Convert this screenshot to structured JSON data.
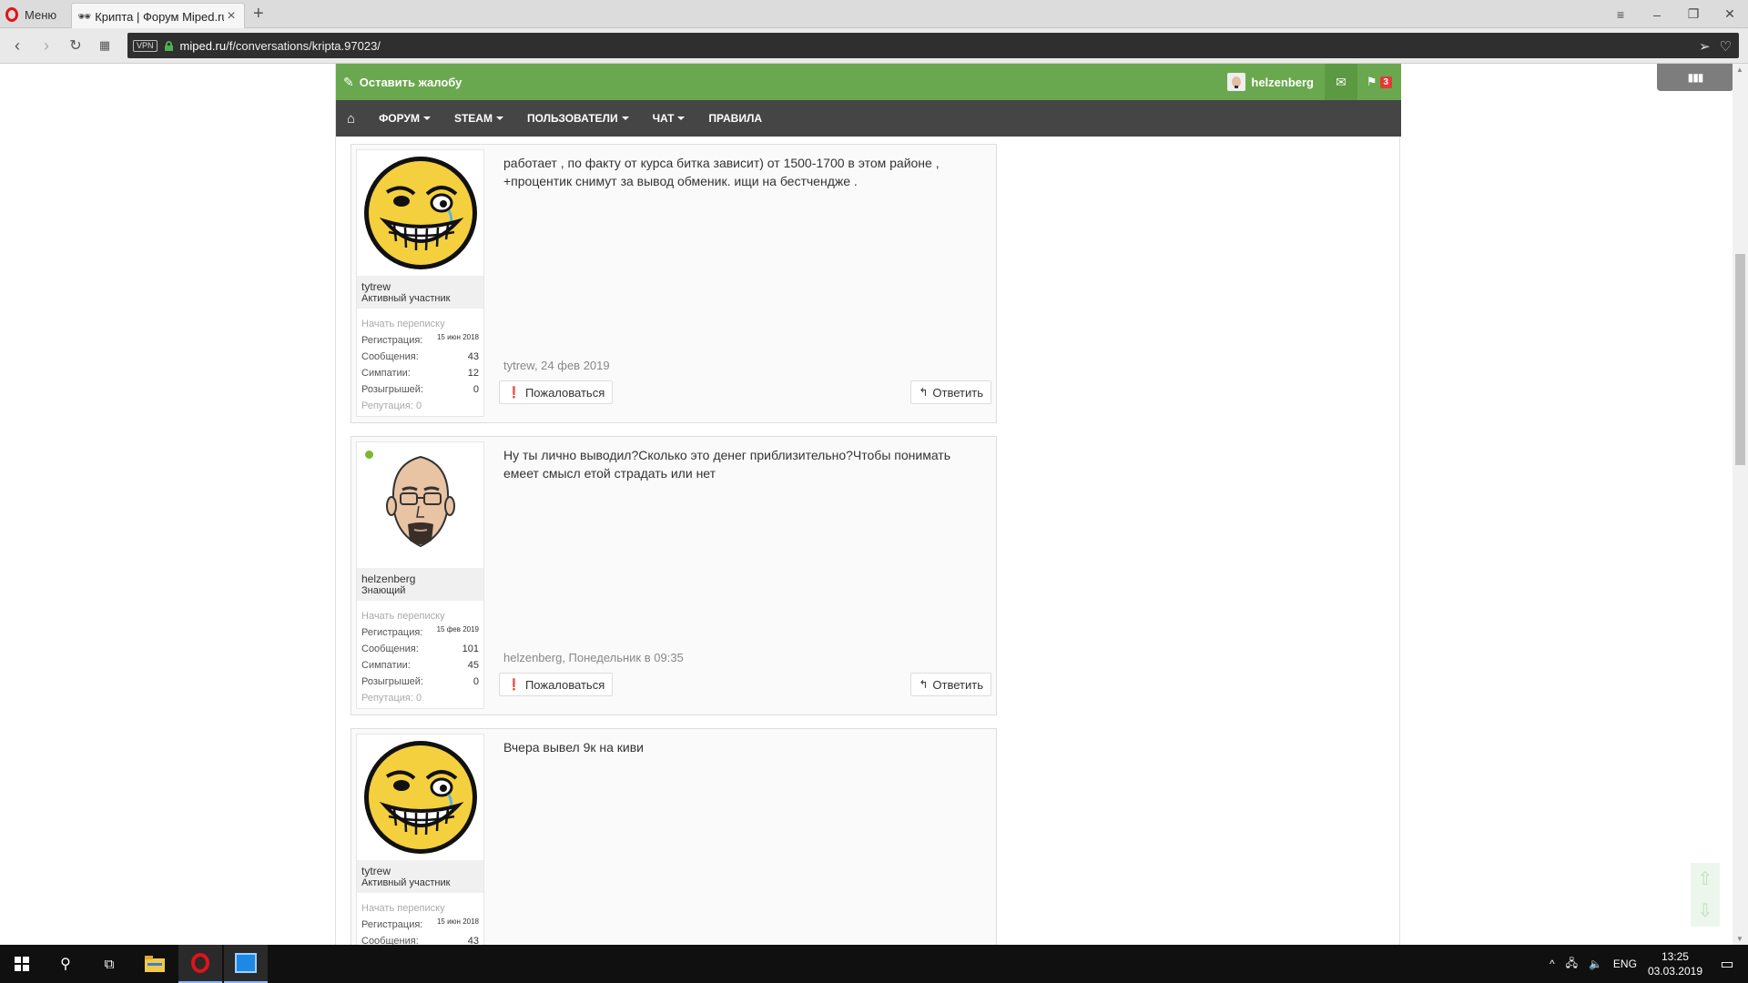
{
  "browser": {
    "menu_label": "Меню",
    "tab_title": "Крипта | Форум Miped.ru",
    "vpn_label": "VPN",
    "url_domain": "miped.ru",
    "url_path": "/f/conversations/kripta.97023/"
  },
  "forum": {
    "report_label": "Оставить жалобу",
    "username": "helzenberg",
    "alerts_count": "3",
    "nav": [
      "ФОРУМ",
      "STEAM",
      "ПОЛЬЗОВАТЕЛИ",
      "ЧАТ",
      "ПРАВИЛА"
    ]
  },
  "labels": {
    "start_conv": "Начать переписку",
    "registration": "Регистрация:",
    "messages": "Сообщения:",
    "likes": "Симпатии:",
    "giveaways": "Розыгрышей:",
    "reputation": "Репутация:",
    "report_btn": "Пожаловаться",
    "reply_btn": "Ответить"
  },
  "messages": [
    {
      "username": "tytrew",
      "title": "Активный участник",
      "registration": "15 июн 2018",
      "messages_count": "43",
      "likes": "12",
      "giveaways": "0",
      "reputation": "0",
      "text": "работает , по факту от курса битка зависит) от 1500-1700 в этом районе , +процентик снимут за вывод обменик. ищи на бестчендже .",
      "meta": "tytrew, 24 фев 2019",
      "online": false
    },
    {
      "username": "helzenberg",
      "title": "Знающий",
      "registration": "15 фев 2019",
      "messages_count": "101",
      "likes": "45",
      "giveaways": "0",
      "reputation": "0",
      "text": "Ну ты лично выводил?Сколько это денег приблизительно?Чтобы понимать емеет смысл етой страдать или нет",
      "meta": "helzenberg, Понедельник в 09:35",
      "online": true
    },
    {
      "username": "tytrew",
      "title": "Активный участник",
      "registration": "15 июн 2018",
      "messages_count": "43",
      "text": "Вчера вывел 9к на киви",
      "online": false
    }
  ],
  "taskbar": {
    "lang": "ENG",
    "time": "13:25",
    "date": "03.03.2019"
  },
  "colors": {
    "topbar_green": "#6aa84f",
    "navbar_dark": "#454545",
    "online_green": "#7cb82f",
    "badge_red": "#e53935"
  }
}
